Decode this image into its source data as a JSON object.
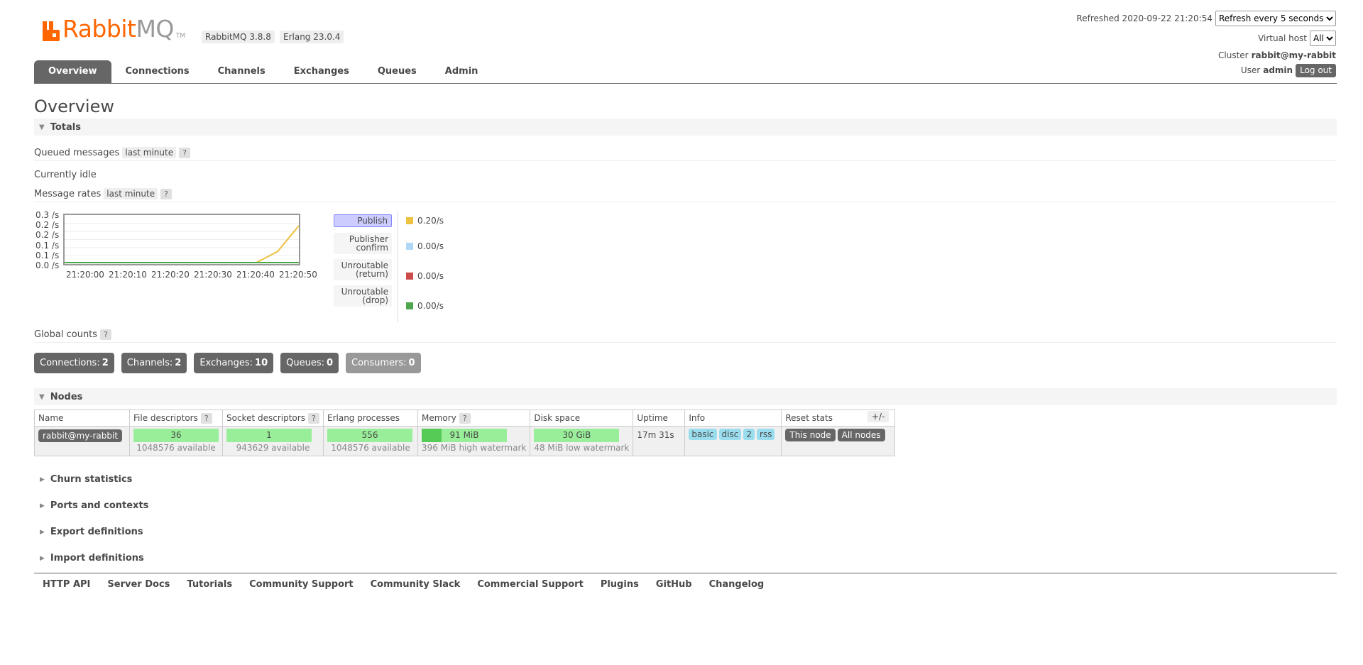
{
  "brand": {
    "name_primary": "Rabbit",
    "name_secondary": "MQ",
    "trademark": "TM",
    "brand_color": "#ff6600",
    "versions": [
      "RabbitMQ 3.8.8",
      "Erlang 23.0.4"
    ]
  },
  "header": {
    "refreshed_label": "Refreshed 2020-09-22 21:20:54",
    "refresh_selected": "Refresh every 5 seconds",
    "vhost_label": "Virtual host",
    "vhost_selected": "All",
    "cluster_label": "Cluster",
    "cluster_value": "rabbit@my-rabbit",
    "user_label": "User",
    "user_value": "admin",
    "logout_label": "Log out"
  },
  "tabs": [
    {
      "label": "Overview",
      "active": true
    },
    {
      "label": "Connections",
      "active": false
    },
    {
      "label": "Channels",
      "active": false
    },
    {
      "label": "Exchanges",
      "active": false
    },
    {
      "label": "Queues",
      "active": false
    },
    {
      "label": "Admin",
      "active": false
    }
  ],
  "page_title": "Overview",
  "totals": {
    "section_label": "Totals",
    "queued_label": "Queued messages",
    "queued_range": "last minute",
    "help": "?",
    "idle_text": "Currently idle",
    "rates_label": "Message rates",
    "rates_range": "last minute"
  },
  "chart_data": {
    "type": "line",
    "title": "",
    "xlabel": "",
    "ylabel": "",
    "y_tick_labels": [
      "0.3 /s",
      "0.2 /s",
      "0.2 /s",
      "0.1 /s",
      "0.1 /s",
      "0.0 /s"
    ],
    "x_tick_labels": [
      "21:20:00",
      "21:20:10",
      "21:20:20",
      "21:20:30",
      "21:20:40",
      "21:20:50"
    ],
    "ylim": [
      0,
      0.25
    ],
    "x_seconds_range": [
      0,
      55
    ],
    "series": [
      {
        "name": "Publish",
        "color": "#edc240",
        "points": [
          [
            0,
            0
          ],
          [
            10,
            0
          ],
          [
            20,
            0
          ],
          [
            30,
            0
          ],
          [
            40,
            0
          ],
          [
            45,
            0
          ],
          [
            50,
            0.06
          ],
          [
            55,
            0.2
          ]
        ]
      },
      {
        "name": "Unroutable (drop)",
        "color": "#4da74d",
        "points": [
          [
            0,
            0
          ],
          [
            55,
            0
          ]
        ]
      }
    ]
  },
  "legend": [
    {
      "label": "Publish",
      "value": "0.20/s",
      "color": "#edc240",
      "active": true
    },
    {
      "label": "Publisher confirm",
      "value": "0.00/s",
      "color": "#afd8f8",
      "active": false
    },
    {
      "label": "Unroutable (return)",
      "value": "0.00/s",
      "color": "#cb4b4b",
      "active": false
    },
    {
      "label": "Unroutable (drop)",
      "value": "0.00/s",
      "color": "#4da74d",
      "active": false
    }
  ],
  "global_counts": {
    "label": "Global counts",
    "items": [
      {
        "label": "Connections:",
        "value": "2"
      },
      {
        "label": "Channels:",
        "value": "2"
      },
      {
        "label": "Exchanges:",
        "value": "10"
      },
      {
        "label": "Queues:",
        "value": "0"
      },
      {
        "label": "Consumers:",
        "value": "0"
      }
    ]
  },
  "nodes": {
    "section_label": "Nodes",
    "columns": [
      "Name",
      "File descriptors",
      "Socket descriptors",
      "Erlang processes",
      "Memory",
      "Disk space",
      "Uptime",
      "Info",
      "Reset stats"
    ],
    "toggle_label": "+/-",
    "row": {
      "name": "rabbit@my-rabbit",
      "file_descriptors": "36",
      "file_descriptors_sub": "1048576 available",
      "socket_descriptors": "1",
      "socket_descriptors_sub": "943629 available",
      "erlang_processes": "556",
      "erlang_processes_sub": "1048576 available",
      "memory": "91 MiB",
      "memory_sub": "396 MiB high watermark",
      "memory_fraction": 0.23,
      "disk_space": "30 GiB",
      "disk_sub": "48 MiB low watermark",
      "uptime": "17m 31s",
      "info_badges": [
        "basic",
        "disc",
        "2",
        "rss"
      ],
      "reset_this": "This node",
      "reset_all": "All nodes"
    }
  },
  "collapsed_sections": [
    "Churn statistics",
    "Ports and contexts",
    "Export definitions",
    "Import definitions"
  ],
  "footer_links": [
    "HTTP API",
    "Server Docs",
    "Tutorials",
    "Community Support",
    "Community Slack",
    "Commercial Support",
    "Plugins",
    "GitHub",
    "Changelog"
  ]
}
